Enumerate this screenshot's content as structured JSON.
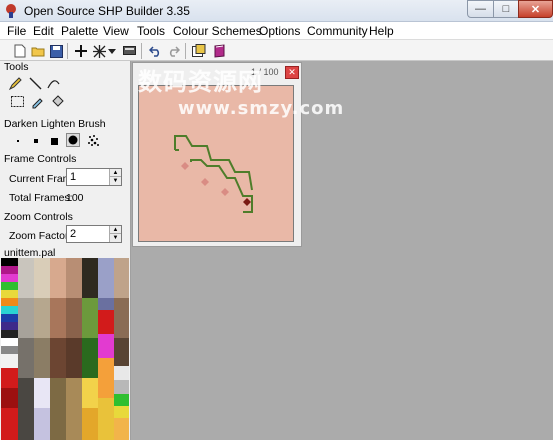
{
  "window": {
    "title": "Open Source SHP Builder 3.35"
  },
  "menu": [
    "File",
    "Edit",
    "Palette",
    "View",
    "Tools",
    "Colour Schemes",
    "Options",
    "Community",
    "Help"
  ],
  "panel": {
    "tools_label": "Tools",
    "brush_label": "Darken Lighten Brush",
    "frame_controls_label": "Frame Controls",
    "current_frame_label": "Current Frame",
    "current_frame_value": "1",
    "total_frames_label": "Total Frames:",
    "total_frames_value": "100",
    "zoom_controls_label": "Zoom Controls",
    "zoom_factor_label": "Zoom Factor",
    "zoom_factor_value": "2",
    "palette_name": "unittem.pal"
  },
  "frame_window": {
    "title_fragment": "1 / 100"
  },
  "watermark": {
    "text": "数码资源网",
    "url": "www.smzy.com"
  },
  "colors": {
    "canvas_bg": "#e9b8a7",
    "workspace_bg": "#ababab",
    "sprite_green": "#4e7d2a"
  }
}
